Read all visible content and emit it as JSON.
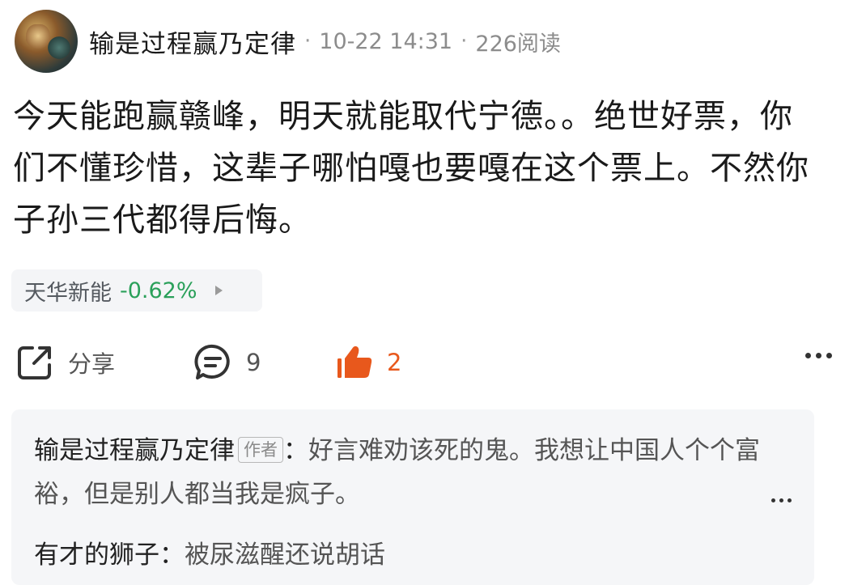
{
  "post": {
    "author": "输是过程赢乃定律",
    "date": "10-22 14:31",
    "reads": "226阅读",
    "separator": "·",
    "content": "今天能跑赢赣峰，明天就能取代宁德。。绝世好票，你们不懂珍惜，这辈子哪怕嘎也要嘎在这个票上。不然你子孙三代都得后悔。"
  },
  "stock": {
    "name": "天华新能",
    "change": "-0.62%",
    "change_color": "#2aa05a"
  },
  "actions": {
    "share_label": "分享",
    "comment_count": "9",
    "like_count": "2",
    "like_color": "#e8581c",
    "icons": [
      "share-icon",
      "comment-icon",
      "thumbs-up-icon",
      "more-icon"
    ]
  },
  "comments": [
    {
      "author": "输是过程赢乃定律",
      "badge": "作者",
      "colon": "：",
      "text": "好言难劝该死的鬼。我想让中国人个个富裕，但是别人都当我是疯子。"
    },
    {
      "author": "有才的狮子",
      "colon": "：",
      "text": "被尿滋醒还说胡话"
    }
  ]
}
